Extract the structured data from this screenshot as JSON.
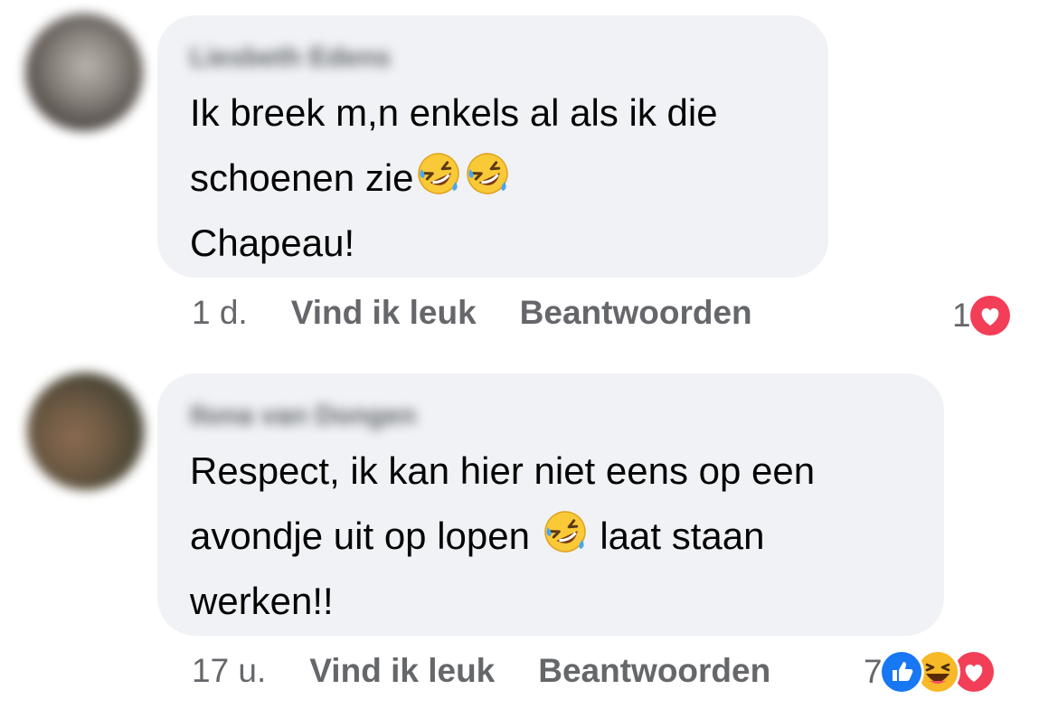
{
  "comments": [
    {
      "author": "Liesbeth Edens",
      "lines": [
        "Ik breek m,n enkels al als ik die",
        "schoenen zie",
        "Chapeau!"
      ],
      "time": "1 d.",
      "like_label": "Vind ik leuk",
      "reply_label": "Beantwoorden",
      "reaction_count": "1",
      "reactions": [
        "heart-icon"
      ]
    },
    {
      "author": "Ilona van Dongen",
      "lines": [
        "Respect, ik kan hier niet eens op een",
        "avondje uit op lopen",
        "laat staan",
        "werken!!"
      ],
      "time": "17 u.",
      "like_label": "Vind ik leuk",
      "reply_label": "Beantwoorden",
      "reaction_count": "7",
      "reactions": [
        "like-icon",
        "haha-icon",
        "heart-icon"
      ]
    }
  ],
  "emoji": "rolling-on-floor-laughing-emoji",
  "colors": {
    "bubble": "#f0f2f5",
    "meta_text": "#65676b",
    "like_blue": "#1877f2",
    "heart_red": "#f33e58",
    "haha_yellow": "#f7b928"
  }
}
